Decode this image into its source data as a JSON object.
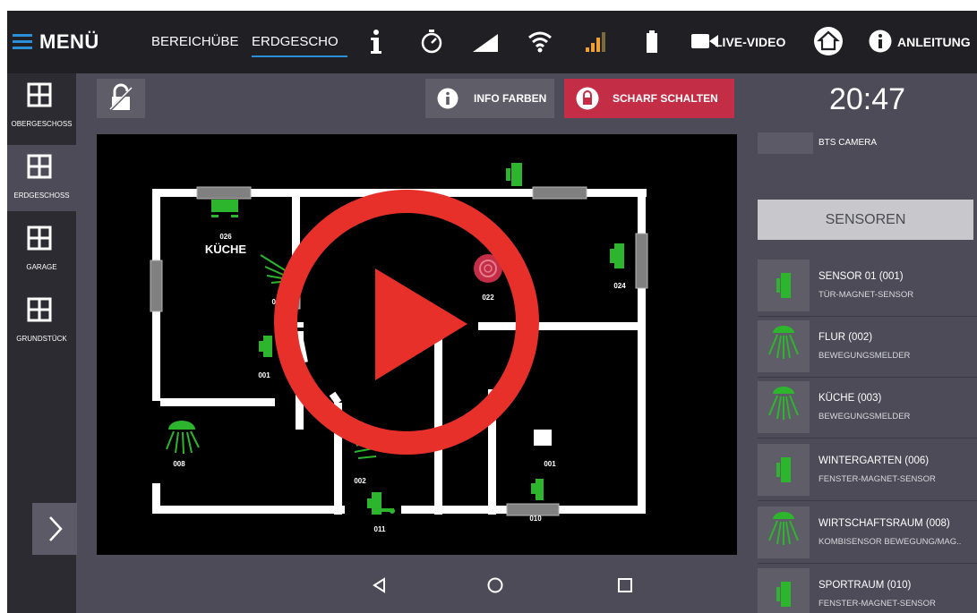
{
  "topbar": {
    "menu_label": "MENÜ",
    "tabs": [
      "BEREICHÜBE",
      "ERDGESCHO"
    ],
    "live_video_label": "LIVE-VIDEO",
    "manual_label": "ANLEITUNG",
    "status_icons": [
      "info-icon",
      "timer-icon",
      "signal-triangle-icon",
      "wifi-icon",
      "cell-signal-icon",
      "battery-icon"
    ]
  },
  "sidebar": {
    "items": [
      {
        "label": "OBERGESCHOSS"
      },
      {
        "label": "ERDGESCHOSS"
      },
      {
        "label": "GARAGE"
      },
      {
        "label": "GRUNDSTÜCK"
      }
    ]
  },
  "toolbar": {
    "info_label": "INFO FARBEN",
    "arm_label": "SCHARF SCHALTEN"
  },
  "map": {
    "room_label": "KÜCHE",
    "device_labels": [
      "026",
      "022",
      "024",
      "001",
      "008",
      "002",
      "011",
      "010",
      "001",
      "00"
    ]
  },
  "right_panel": {
    "time": "20:47",
    "camera_label": "BTS CAMERA",
    "sensors_button": "SENSOREN",
    "sensors": [
      {
        "name": "SENSOR 01 (001)",
        "type": "TÜR-MAGNET-SENSOR",
        "icon": "door-sensor-icon"
      },
      {
        "name": "FLUR (002)",
        "type": "BEWEGUNGSMELDER",
        "icon": "motion-sensor-icon"
      },
      {
        "name": "KÜCHE (003)",
        "type": "BEWEGUNGSMELDER",
        "icon": "motion-sensor-icon"
      },
      {
        "name": "WINTERGARTEN (006)",
        "type": "FENSTER-MAGNET-SENSOR",
        "icon": "door-sensor-icon"
      },
      {
        "name": "WIRTSCHAFTSRAUM (008)",
        "type": "KOMBISENSOR BEWEGUNG/MAG..",
        "icon": "motion-sensor-icon"
      },
      {
        "name": "SPORTRAUM (010)",
        "type": "FENSTER-MAGNET-SENSOR",
        "icon": "door-sensor-icon"
      }
    ]
  },
  "colors": {
    "accent": "#2a8fd6",
    "arm": "#c32d46",
    "sensor_green": "#2db52d",
    "play_red": "#e8302a"
  }
}
